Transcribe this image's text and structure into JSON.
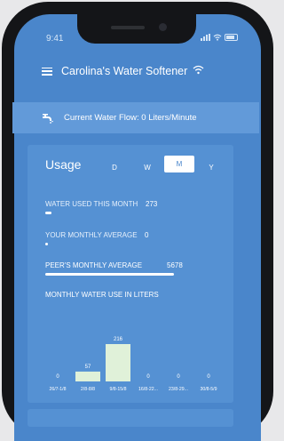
{
  "status_bar": {
    "time": "9:41"
  },
  "header": {
    "title": "Carolina's Water Softener"
  },
  "flow": {
    "text": "Current Water Flow: 0 Liters/Minute"
  },
  "usage": {
    "title": "Usage",
    "periods": [
      "D",
      "W",
      "M",
      "Y"
    ],
    "active_period": "M",
    "stats": [
      {
        "label": "WATER USED THIS MONTH",
        "value": "273",
        "fraction": 0.05
      },
      {
        "label": "YOUR MONTHLY AVERAGE",
        "value": "0",
        "fraction": 0.01
      },
      {
        "label": "PEER'S MONTHLY AVERAGE",
        "value": "5678",
        "fraction": 1.0
      }
    ],
    "chart_title": "MONTHLY WATER USE IN LITERS"
  },
  "chart_data": {
    "type": "bar",
    "categories": [
      "26/7-1/8",
      "2/8-8/8",
      "9/8-15/8",
      "16/8-22...",
      "23/8-29...",
      "30/8-5/9"
    ],
    "values": [
      0,
      57,
      216,
      0,
      0,
      0
    ],
    "title": "MONTHLY WATER USE IN LITERS",
    "ylim": [
      0,
      216
    ]
  },
  "colors": {
    "background": "#4a86cb",
    "card": "#5591d3",
    "bar": "#e0f1d9",
    "accent": "#629ad9"
  },
  "icons": {
    "menu": "menu-icon",
    "wifi": "wifi-icon",
    "flow": "faucet-icon"
  }
}
